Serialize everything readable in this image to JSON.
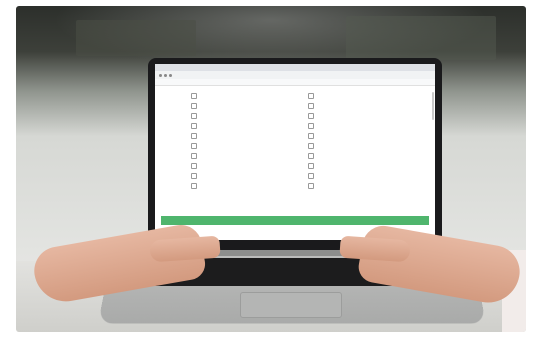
{
  "browser": {
    "url": "",
    "bookmarks": [
      "",
      "",
      "",
      "",
      "",
      "",
      "",
      ""
    ]
  },
  "survey": {
    "question": "",
    "options_left": [
      "",
      "",
      "",
      "",
      "",
      "",
      "",
      "",
      "",
      ""
    ],
    "options_right": [
      "",
      "",
      "",
      "",
      "",
      "",
      "",
      "",
      "",
      ""
    ],
    "submit_label": ""
  },
  "colors": {
    "submit_bar": "#4fb56d",
    "screen_bg": "#ffffff",
    "laptop_body": "#b4b5b4"
  }
}
